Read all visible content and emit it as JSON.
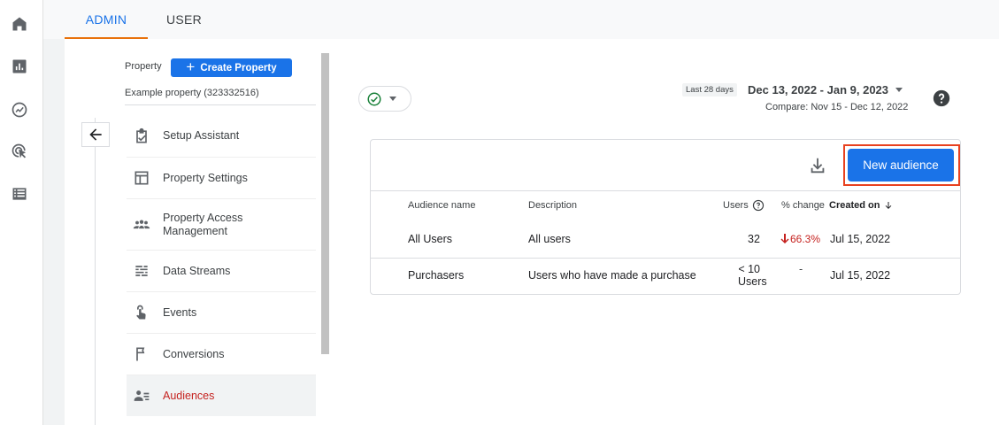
{
  "tabs": [
    {
      "label": "ADMIN",
      "active": true
    },
    {
      "label": "USER",
      "active": false
    }
  ],
  "rail": [
    "home-icon",
    "reports-icon",
    "explore-icon",
    "advertising-icon",
    "configure-icon"
  ],
  "property": {
    "label": "Property",
    "create_label": "Create Property",
    "name": "Example property (323332516)"
  },
  "nav": [
    {
      "label": "Setup Assistant",
      "icon": "checklist-icon"
    },
    {
      "label": "Property Settings",
      "icon": "settings-window-icon"
    },
    {
      "label": "Property Access Management",
      "icon": "people-icon"
    },
    {
      "label": "Data Streams",
      "icon": "data-streams-icon"
    },
    {
      "label": "Events",
      "icon": "touch-icon"
    },
    {
      "label": "Conversions",
      "icon": "flag-icon"
    },
    {
      "label": "Audiences",
      "icon": "audience-icon",
      "selected": true
    }
  ],
  "date": {
    "badge": "Last 28 days",
    "range": "Dec 13, 2022 - Jan 9, 2023",
    "compare": "Compare: Nov 15 - Dec 12, 2022"
  },
  "table": {
    "new_button": "New audience",
    "headers": {
      "name": "Audience name",
      "description": "Description",
      "users": "Users",
      "change": "% change",
      "created": "Created on"
    },
    "rows": [
      {
        "name": "All Users",
        "description": "All users",
        "users": "32",
        "change": "66.3%",
        "created": "Jul 15, 2022"
      },
      {
        "name": "Purchasers",
        "description": "Users who have made a purchase",
        "users_line1": "< 10",
        "users_line2": "Users",
        "change": "-",
        "created": "Jul 15, 2022"
      }
    ]
  },
  "colors": {
    "accent": "#1a73e8",
    "tab_indicator": "#e8710a",
    "negative": "#c5221f",
    "highlight_box": "#e8411f",
    "success": "#188038"
  }
}
